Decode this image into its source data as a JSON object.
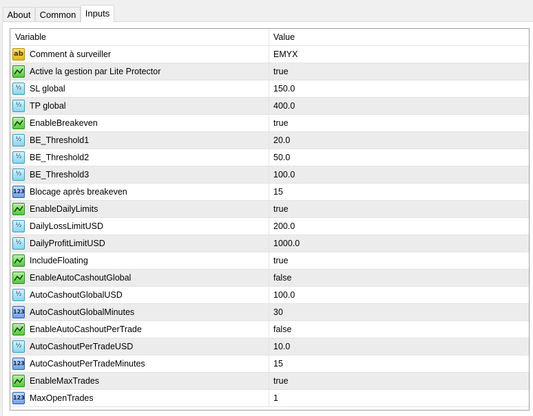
{
  "tabs": [
    {
      "label": "About",
      "active": false
    },
    {
      "label": "Common",
      "active": false
    },
    {
      "label": "Inputs",
      "active": true
    }
  ],
  "table": {
    "columns": {
      "variable": "Variable",
      "value": "Value"
    },
    "rows": [
      {
        "type": "string",
        "icon": "ab-string-icon",
        "icon_text": "ab",
        "name": "Comment à surveiller",
        "value": "EMYX"
      },
      {
        "type": "bool",
        "icon": "bool-icon",
        "icon_text": "",
        "name": "Active la gestion par Lite Protector",
        "value": "true"
      },
      {
        "type": "double",
        "icon": "double-icon",
        "icon_text": "½",
        "name": "SL global",
        "value": "150.0"
      },
      {
        "type": "double",
        "icon": "double-icon",
        "icon_text": "½",
        "name": "TP global",
        "value": "400.0"
      },
      {
        "type": "bool",
        "icon": "bool-icon",
        "icon_text": "",
        "name": "EnableBreakeven",
        "value": "true"
      },
      {
        "type": "double",
        "icon": "double-icon",
        "icon_text": "½",
        "name": "BE_Threshold1",
        "value": "20.0"
      },
      {
        "type": "double",
        "icon": "double-icon",
        "icon_text": "½",
        "name": "BE_Threshold2",
        "value": "50.0"
      },
      {
        "type": "double",
        "icon": "double-icon",
        "icon_text": "½",
        "name": "BE_Threshold3",
        "value": "100.0"
      },
      {
        "type": "int",
        "icon": "int-icon",
        "icon_text": "123",
        "name": "Blocage après breakeven",
        "value": "15"
      },
      {
        "type": "bool",
        "icon": "bool-icon",
        "icon_text": "",
        "name": "EnableDailyLimits",
        "value": "true"
      },
      {
        "type": "double",
        "icon": "double-icon",
        "icon_text": "½",
        "name": "DailyLossLimitUSD",
        "value": "200.0"
      },
      {
        "type": "double",
        "icon": "double-icon",
        "icon_text": "½",
        "name": "DailyProfitLimitUSD",
        "value": "1000.0"
      },
      {
        "type": "bool",
        "icon": "bool-icon",
        "icon_text": "",
        "name": "IncludeFloating",
        "value": "true"
      },
      {
        "type": "bool",
        "icon": "bool-icon",
        "icon_text": "",
        "name": "EnableAutoCashoutGlobal",
        "value": "false"
      },
      {
        "type": "double",
        "icon": "double-icon",
        "icon_text": "½",
        "name": "AutoCashoutGlobalUSD",
        "value": "100.0"
      },
      {
        "type": "int",
        "icon": "int-icon",
        "icon_text": "123",
        "name": "AutoCashoutGlobalMinutes",
        "value": "30"
      },
      {
        "type": "bool",
        "icon": "bool-icon",
        "icon_text": "",
        "name": "EnableAutoCashoutPerTrade",
        "value": "false"
      },
      {
        "type": "double",
        "icon": "double-icon",
        "icon_text": "½",
        "name": "AutoCashoutPerTradeUSD",
        "value": "10.0"
      },
      {
        "type": "int",
        "icon": "int-icon",
        "icon_text": "123",
        "name": "AutoCashoutPerTradeMinutes",
        "value": "15"
      },
      {
        "type": "bool",
        "icon": "bool-icon",
        "icon_text": "",
        "name": "EnableMaxTrades",
        "value": "true"
      },
      {
        "type": "int",
        "icon": "int-icon",
        "icon_text": "123",
        "name": "MaxOpenTrades",
        "value": "1"
      }
    ]
  }
}
